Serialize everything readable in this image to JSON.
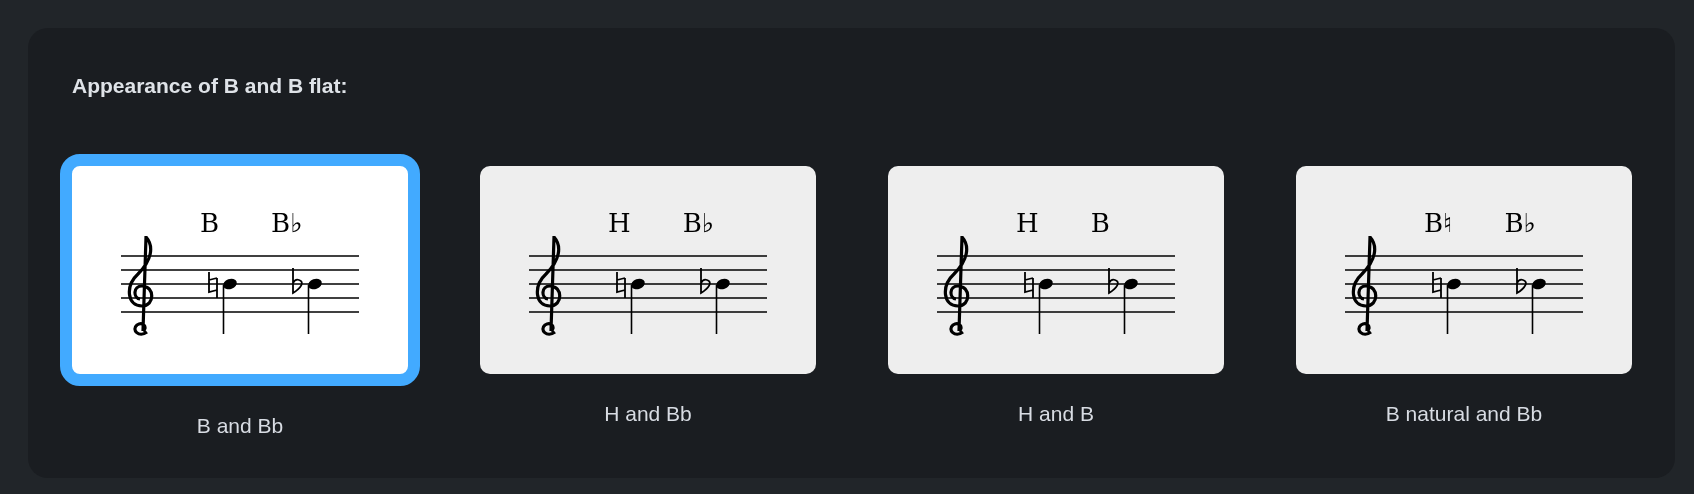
{
  "section": {
    "title": "Appearance of B and B flat:"
  },
  "options": [
    {
      "label": "B and Bb",
      "selected": true,
      "chord_names": [
        "B",
        "B♭"
      ]
    },
    {
      "label": "H and Bb",
      "selected": false,
      "chord_names": [
        "H",
        "B♭"
      ]
    },
    {
      "label": "H and B",
      "selected": false,
      "chord_names": [
        "H",
        "B"
      ]
    },
    {
      "label": "B natural and Bb",
      "selected": false,
      "chord_names": [
        "B♮",
        "B♭"
      ]
    }
  ]
}
